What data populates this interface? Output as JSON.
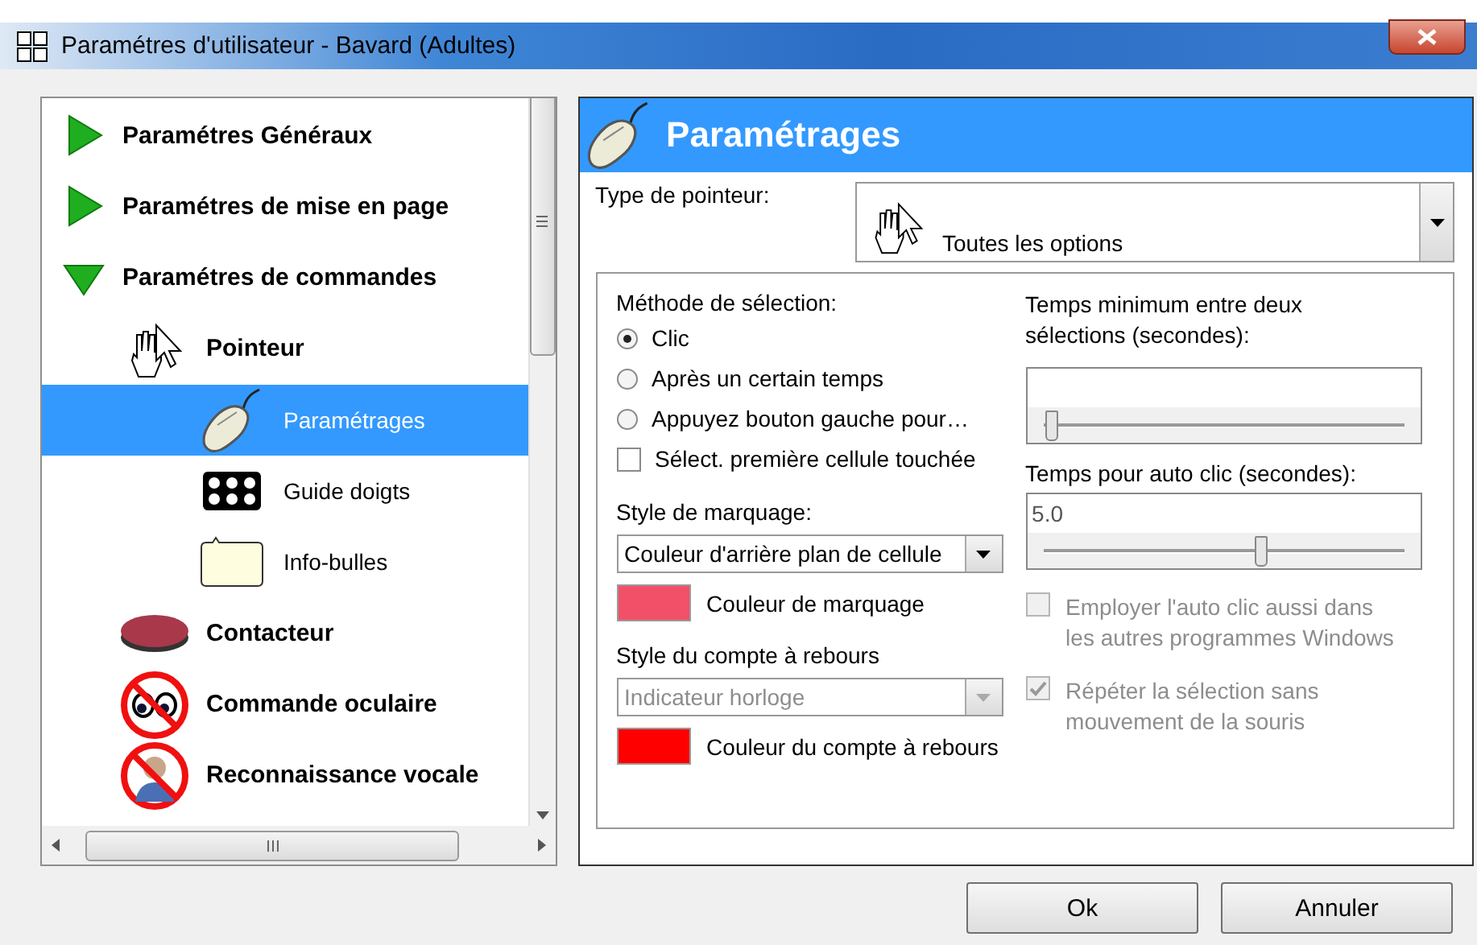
{
  "window": {
    "title": "Paramétres d'utilisateur - Bavard (Adultes)"
  },
  "tree": [
    {
      "label": "Paramétres Généraux",
      "kind": "arrow",
      "expanded": false,
      "selected": false
    },
    {
      "label": "Paramétres de mise en page",
      "kind": "arrow",
      "expanded": false,
      "selected": false
    },
    {
      "label": "Paramétres de commandes",
      "kind": "arrow",
      "expanded": true,
      "selected": false,
      "children": [
        {
          "label": "Pointeur",
          "kind": "pointer",
          "selected": false,
          "children": [
            {
              "label": "Paramétrages",
              "kind": "mouse",
              "selected": true
            },
            {
              "label": "Guide doigts",
              "kind": "grid",
              "selected": false
            },
            {
              "label": "Info-bulles",
              "kind": "bubble",
              "selected": false
            }
          ]
        },
        {
          "label": "Contacteur",
          "kind": "switch",
          "selected": false
        },
        {
          "label": "Commande oculaire",
          "kind": "eyes-off",
          "selected": false
        },
        {
          "label": "Reconnaissance vocale",
          "kind": "voice-off",
          "selected": false
        }
      ]
    }
  ],
  "panel": {
    "title": "Paramétrages",
    "pointer_type": {
      "label": "Type de pointeur:",
      "value": "Toutes les options"
    },
    "selection_method": {
      "label": "Méthode de sélection:",
      "options": [
        {
          "label": "Clic",
          "selected": true
        },
        {
          "label": "Après un certain temps",
          "selected": false
        },
        {
          "label": "Appuyez bouton gauche pour…",
          "selected": false
        }
      ]
    },
    "first_cell": {
      "label": "Sélect. première cellule touchée",
      "checked": false
    },
    "marking_style": {
      "label": "Style de marquage:",
      "value": "Couleur d'arrière plan de cellule",
      "disabled": false
    },
    "marking_color": {
      "label": "Couleur de marquage",
      "color": "#f25068"
    },
    "countdown_style": {
      "label": "Style du compte à rebours",
      "value": "Indicateur horloge",
      "disabled": true
    },
    "countdown_color": {
      "label": "Couleur du compte à rebours",
      "color": "#ff0000"
    },
    "min_time": {
      "label": "Temps minimum entre deux sélections (secondes):",
      "level": 0.02
    },
    "auto_click": {
      "label": "Temps pour auto clic (secondes):",
      "value": "5.0",
      "level": 0.6
    },
    "options": [
      {
        "label": "Employer l'auto clic aussi dans les autres programmes Windows",
        "checked": false,
        "disabled": true
      },
      {
        "label": "Répéter la sélection sans mouvement de la souris",
        "checked": true,
        "disabled": true
      }
    ]
  },
  "buttons": [
    "Ok",
    "Annuler"
  ]
}
